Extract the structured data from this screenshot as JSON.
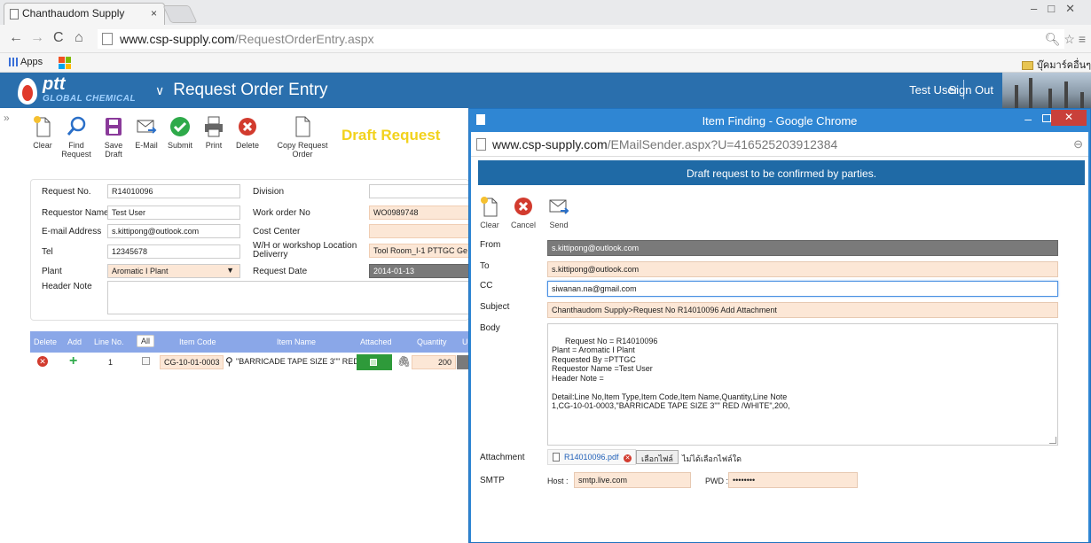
{
  "browser": {
    "tab_title": "Chanthaudom Supply",
    "tab_close": "×",
    "url_host": "www.csp-supply.com",
    "url_path": "/RequestOrderEntry.aspx",
    "apps_label": "Apps",
    "bookmark_folder": "บุ๊คมาร์คอื่นๆ"
  },
  "header": {
    "logo_ptt": "ptt",
    "logo_sub": "GLOBAL CHEMICAL",
    "title": "Request Order Entry",
    "user": "Test User",
    "sign_out": "Sign Out"
  },
  "actions": [
    {
      "label": "Clear",
      "icon": "new-document-icon"
    },
    {
      "label": "Find Request",
      "icon": "search-icon"
    },
    {
      "label": "Save Draft",
      "icon": "save-icon"
    },
    {
      "label": "E-Mail",
      "icon": "email-icon"
    },
    {
      "label": "Submit",
      "icon": "check-circle-icon"
    },
    {
      "label": "Print",
      "icon": "printer-icon"
    },
    {
      "label": "Delete",
      "icon": "delete-circle-icon"
    },
    {
      "label": "Copy Request Order",
      "icon": "copy-document-icon"
    }
  ],
  "status_label": "Draft Request",
  "form": {
    "request_no_label": "Request No.",
    "request_no": "R14010096",
    "requestor_label": "Requestor Name",
    "requestor": "Test User",
    "email_label": "E-mail Address",
    "email": "s.kittipong@outlook.com",
    "tel_label": "Tel",
    "tel": "12345678",
    "plant_label": "Plant",
    "plant": "Aromatic I Plant",
    "header_note_label": "Header Note",
    "division_label": "Division",
    "division": "",
    "work_order_label": "Work order No",
    "work_order": "WO0989748",
    "cost_center_label": "Cost Center",
    "cost_center": "",
    "location_label": "W/H or workshop Location Deliverry",
    "location": "Tool Room_I-1 PTTGC Ge",
    "request_date_label": "Request Date",
    "request_date": "2014-01-13"
  },
  "grid": {
    "headers": {
      "delete": "Delete",
      "add": "Add",
      "line_no": "Line No.",
      "all": "All",
      "item_code": "Item Code",
      "item_name": "Item Name",
      "attached": "Attached",
      "quantity": "Quantity",
      "unit": "U"
    },
    "rows": [
      {
        "line_no": "1",
        "item_code": "CG-10-01-0003",
        "item_name": "\"BARRICADE TAPE SIZE 3\"\" RED",
        "quantity": "200"
      }
    ]
  },
  "popup": {
    "window_title": "Item Finding - Google Chrome",
    "url_host": "www.csp-supply.com",
    "url_path": "/EMailSender.aspx?U=416525203912384",
    "banner": "Draft request to be confirmed by parties.",
    "actions": [
      {
        "label": "Clear",
        "icon": "new-document-icon"
      },
      {
        "label": "Cancel",
        "icon": "cancel-circle-icon"
      },
      {
        "label": "Send",
        "icon": "send-mail-icon"
      }
    ],
    "from_label": "From",
    "from": "s.kittipong@outlook.com",
    "to_label": "To",
    "to": "s.kittipong@outlook.com",
    "cc_label": "CC",
    "cc": "siwanan.na@gmail.com",
    "subject_label": "Subject",
    "subject": "Chanthaudom Supply>Request No R14010096 Add Attachment",
    "body_label": "Body",
    "body": "Request No = R14010096\nPlant = Aromatic I Plant\nRequested By =PTTGC\nRequestor Name =Test User\nHeader Note =\n\nDetail:Line No,Item Type,Item Code,Item Name,Quantity,Line Note\n1,CG-10-01-0003,\"BARRICADE TAPE SIZE 3\"\" RED /WHITE\",200,",
    "attachment_label": "Attachment",
    "attachment_file": "R14010096.pdf",
    "choose_file": "เลือกไฟล์",
    "no_file": "ไม่ได้เลือกไฟล์ใด",
    "smtp_label": "SMTP",
    "host_label": "Host :",
    "host": "smtp.live.com",
    "pwd_label": "PWD :",
    "pwd": "••••••••"
  }
}
